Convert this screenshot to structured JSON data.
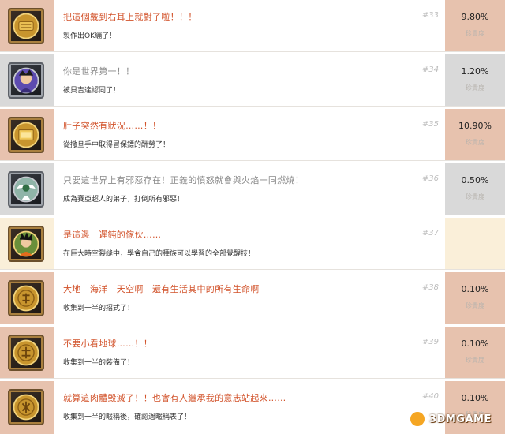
{
  "rarity_label": "珍貴度",
  "rows": [
    {
      "icon": "gold-ticket-icon",
      "title": "把這個戴到右耳上就對了啦！！！",
      "desc": "製作出OK繃了！",
      "number": "#33",
      "percent": "9.80%"
    },
    {
      "icon": "fighter-portrait-icon",
      "title": "你是世界第一！！",
      "desc": "被貝吉達認同了！",
      "number": "#34",
      "percent": "1.20%"
    },
    {
      "icon": "gold-treasure-icon",
      "title": "肚子突然有狀況……！！",
      "desc": "從撒旦手中取得冒保鏢的酬勞了！",
      "number": "#35",
      "percent": "10.90%"
    },
    {
      "icon": "angel-figure-icon",
      "title": "只要這世界上有邪惡存在！正義的憤怒就會與火焰一同燃燒！",
      "desc": "成為賽亞超人的弟子，打倒所有邪惡！",
      "number": "#36",
      "percent": "0.50%"
    },
    {
      "icon": "goku-portrait-icon",
      "title": "是這邊　遲鈍的傢伙……",
      "desc": "在巨大時空裂縫中，學會自己的種族可以學習的全部覺醒技！",
      "number": "#37",
      "percent": ""
    },
    {
      "icon": "gold-coin-icon",
      "title": "大地　海洋　天空啊　還有生活其中的所有生命啊",
      "desc": "收集到一半的招式了！",
      "number": "#38",
      "percent": "0.10%"
    },
    {
      "icon": "gold-coin-icon",
      "title": "不要小看地球……！！",
      "desc": "收集到一半的裝備了！",
      "number": "#39",
      "percent": "0.10%"
    },
    {
      "icon": "gold-coin-icon",
      "title": "就算這肉體毀滅了！！也會有人繼承我的意志站起來……",
      "desc": "收集到一半的暱稱後，確認過暱稱表了！",
      "number": "#40",
      "percent": "0.10%"
    }
  ],
  "watermark": "3DMGAME"
}
